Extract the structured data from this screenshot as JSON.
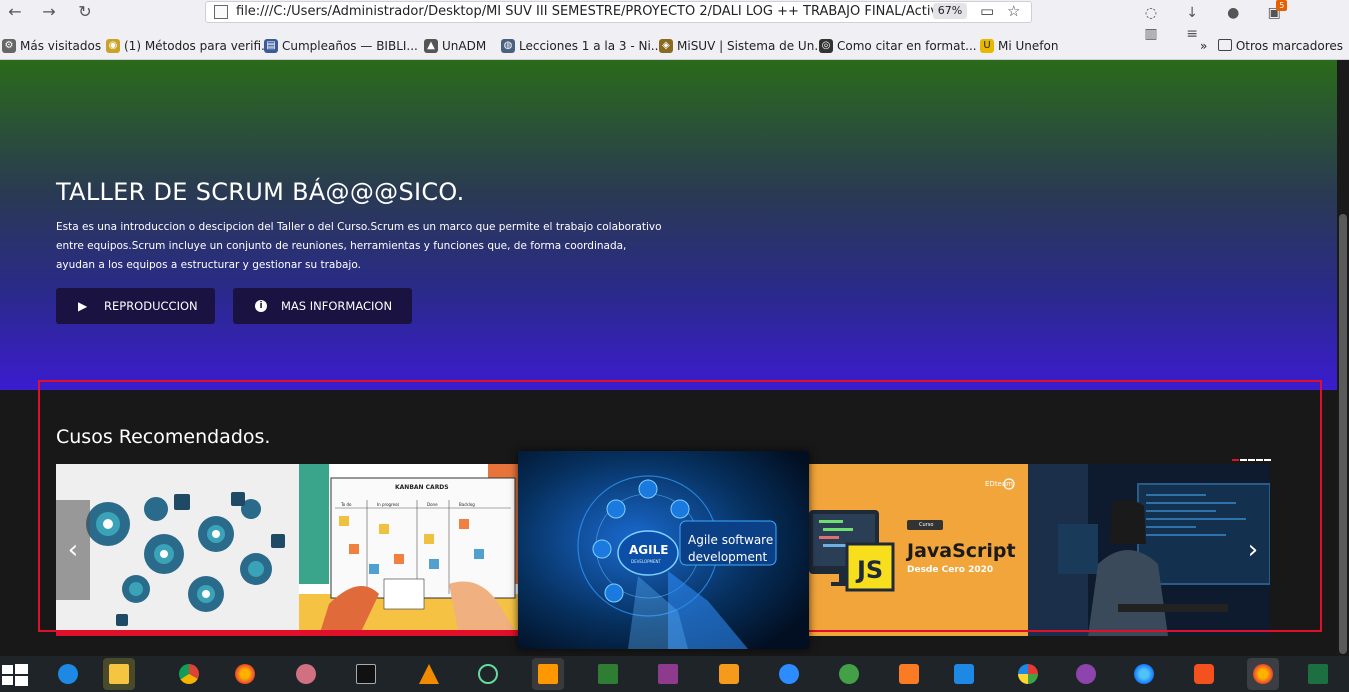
{
  "browser": {
    "url": "file:///C:/Users/Administrador/Desktop/MI SUV III SEMESTRE/PROYECTO 2/DALI LOG ++ TRABAJO FINAL/Activi",
    "zoom": "67%",
    "bookmarks": [
      "Más visitados",
      "(1) Métodos para verifi...",
      "Cumpleaños — BIBLI...",
      "UnADM",
      "Lecciones 1 a la 3 - Ni...",
      "MiSUV | Sistema de Un...",
      "Como citar en format...",
      "Mi Unefon"
    ],
    "other_bookmarks": "Otros marcadores",
    "notification_badge": "5"
  },
  "hero": {
    "title": "TALLER DE SCRUM BÁ@@@SICO.",
    "description": "Esta es una introduccion o descipcion del Taller o del Curso.Scrum es un marco que permite el trabajo colaborativo entre equipos.Scrum incluye un conjunto de reuniones, herramientas y funciones que, de forma coordinada, ayudan a los equipos a estructurar y gestionar su trabajo.",
    "play_label": "REPRODUCCION",
    "info_label": "MAS INFORMACION"
  },
  "recommended": {
    "title": "Cusos Recomendados.",
    "cards": [
      {
        "image": "gears-icons"
      },
      {
        "image": "kanban-board",
        "caption": "KANBAN CARDS",
        "columns": [
          "To do",
          "In progress",
          "Done",
          "Backlog"
        ]
      },
      {
        "image": "agile-hand",
        "badge": "AGILE",
        "badge_sub": "DEVELOPMENT",
        "text1": "Agile software",
        "text2": "development"
      },
      {
        "image": "javascript-course",
        "brand": "EDteam",
        "tag": "Curso",
        "js": "JS",
        "text1": "JavaScript",
        "text2": "Desde Cero 2020"
      },
      {
        "image": "developer-screens"
      }
    ],
    "prev_arrow": "‹",
    "next_arrow": "›"
  },
  "colors": {
    "accent_red": "#e0102a",
    "button_bg": "#1a1240",
    "hero_bottom": "#3b1ccf"
  }
}
